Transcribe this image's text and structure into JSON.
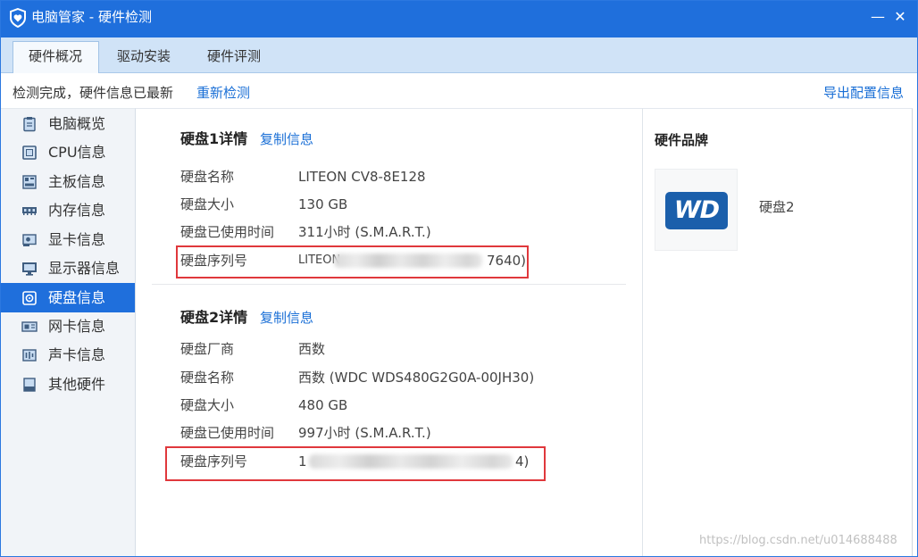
{
  "window": {
    "title": "电脑管家 - 硬件检测",
    "minimize_label": "—",
    "close_label": "✕"
  },
  "tabs": [
    {
      "label": "硬件概况",
      "active": true
    },
    {
      "label": "驱动安装",
      "active": false
    },
    {
      "label": "硬件评测",
      "active": false
    }
  ],
  "toolbar": {
    "status": "检测完成，硬件信息已最新",
    "recheck": "重新检测",
    "export": "导出配置信息"
  },
  "sidebar": {
    "items": [
      {
        "label": "电脑概览",
        "icon": "overview-icon",
        "active": false
      },
      {
        "label": "CPU信息",
        "icon": "cpu-icon",
        "active": false
      },
      {
        "label": "主板信息",
        "icon": "motherboard-icon",
        "active": false
      },
      {
        "label": "内存信息",
        "icon": "memory-icon",
        "active": false
      },
      {
        "label": "显卡信息",
        "icon": "graphics-card-icon",
        "active": false
      },
      {
        "label": "显示器信息",
        "icon": "monitor-icon",
        "active": false
      },
      {
        "label": "硬盘信息",
        "icon": "hard-disk-icon",
        "active": true
      },
      {
        "label": "网卡信息",
        "icon": "network-card-icon",
        "active": false
      },
      {
        "label": "声卡信息",
        "icon": "sound-card-icon",
        "active": false
      },
      {
        "label": "其他硬件",
        "icon": "other-hardware-icon",
        "active": false
      }
    ]
  },
  "disks": [
    {
      "title": "硬盘1详情",
      "copy": "复制信息",
      "rows": [
        {
          "label": "硬盘名称",
          "value": "LITEON CV8-8E128"
        },
        {
          "label": "硬盘大小",
          "value": "130 GB"
        },
        {
          "label": "硬盘已使用时间",
          "value": "311小时 (S.M.A.R.T.)"
        }
      ],
      "serial": {
        "label": "硬盘序列号",
        "prefix": "LITEON",
        "suffix": "7640)"
      }
    },
    {
      "title": "硬盘2详情",
      "copy": "复制信息",
      "rows": [
        {
          "label": "硬盘厂商",
          "value": "西数"
        },
        {
          "label": "硬盘名称",
          "value": "西数 (WDC WDS480G2G0A-00JH30)"
        },
        {
          "label": "硬盘大小",
          "value": "480 GB"
        },
        {
          "label": "硬盘已使用时间",
          "value": "997小时 (S.M.A.R.T.)"
        }
      ],
      "serial": {
        "label": "硬盘序列号",
        "prefix": "1",
        "suffix": "4)"
      }
    }
  ],
  "brand": {
    "title": "硬件品牌",
    "logo_text": "WD",
    "name": "硬盘2"
  },
  "watermark": "https://blog.csdn.net/u014688488",
  "colors": {
    "titlebar": "#1f6fdc",
    "accent_link": "#1a6fd6",
    "tabbar": "#d0e3f7",
    "sidebar_bg": "#f1f4f8",
    "sidebar_active": "#1f6fdc",
    "highlight_box": "#e0383c",
    "wd_blue": "#1b5fab"
  }
}
